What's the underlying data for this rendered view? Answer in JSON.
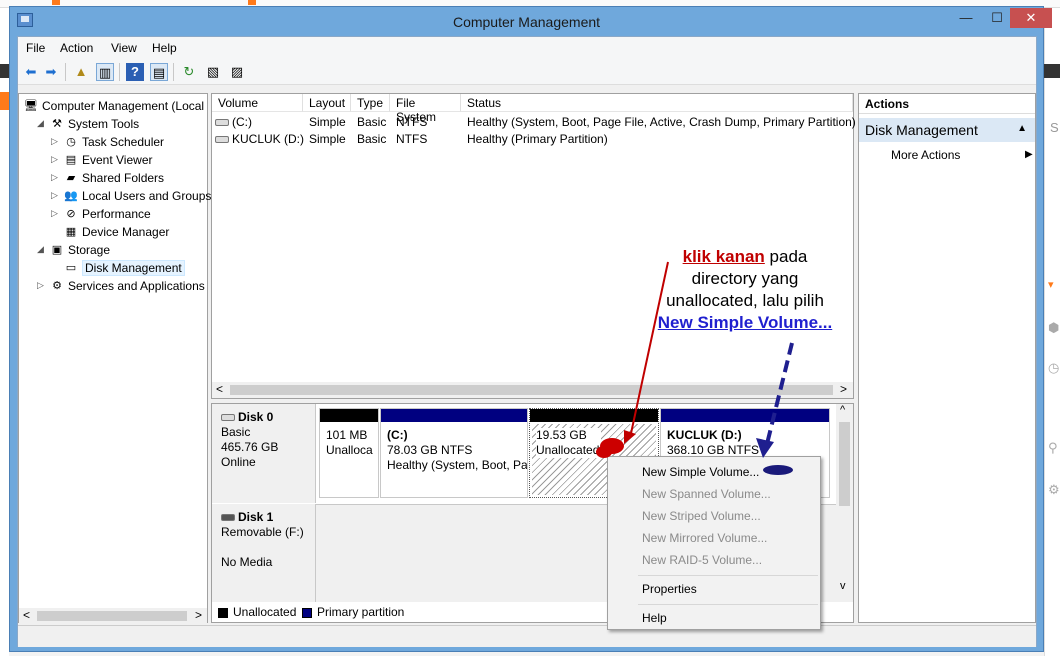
{
  "window": {
    "title": "Computer Management",
    "close_glyph": "✕",
    "min_glyph": "—",
    "max_glyph": "☐"
  },
  "menu": [
    "File",
    "Action",
    "View",
    "Help"
  ],
  "tree": {
    "items": [
      {
        "label": "Computer Management (Local",
        "icon": "computer-icon",
        "glyph": "🖥",
        "indent": 0,
        "twisty": ""
      },
      {
        "label": "System Tools",
        "icon": "tools-icon",
        "glyph": "⚒",
        "indent": 1,
        "twisty": "◢"
      },
      {
        "label": "Task Scheduler",
        "icon": "clock-icon",
        "glyph": "◷",
        "indent": 2,
        "twisty": "▷"
      },
      {
        "label": "Event Viewer",
        "icon": "event-viewer-icon",
        "glyph": "▤",
        "indent": 2,
        "twisty": "▷"
      },
      {
        "label": "Shared Folders",
        "icon": "shared-folder-icon",
        "glyph": "▰",
        "indent": 2,
        "twisty": "▷"
      },
      {
        "label": "Local Users and Groups",
        "icon": "users-icon",
        "glyph": "👥",
        "indent": 2,
        "twisty": "▷"
      },
      {
        "label": "Performance",
        "icon": "performance-icon",
        "glyph": "⊘",
        "indent": 2,
        "twisty": "▷"
      },
      {
        "label": "Device Manager",
        "icon": "device-manager-icon",
        "glyph": "▦",
        "indent": 2,
        "twisty": ""
      },
      {
        "label": "Storage",
        "icon": "storage-icon",
        "glyph": "▣",
        "indent": 1,
        "twisty": "◢"
      },
      {
        "label": "Disk Management",
        "icon": "disk-icon",
        "glyph": "▭",
        "indent": 2,
        "twisty": ""
      },
      {
        "label": "Services and Applications",
        "icon": "services-icon",
        "glyph": "⚙",
        "indent": 1,
        "twisty": "▷"
      }
    ],
    "scroll_left": "<",
    "scroll_right": ">"
  },
  "volumes": {
    "headers": [
      "Volume",
      "Layout",
      "Type",
      "File System",
      "Status"
    ],
    "rows": [
      [
        "(C:)",
        "Simple",
        "Basic",
        "NTFS",
        "Healthy (System, Boot, Page File, Active, Crash Dump, Primary Partition)"
      ],
      [
        "KUCLUK (D:)",
        "Simple",
        "Basic",
        "NTFS",
        "Healthy (Primary Partition)"
      ]
    ],
    "scroll_left": "<",
    "scroll_right": ">"
  },
  "disks": [
    {
      "name": "Disk 0",
      "type": "Basic",
      "size": "465.76 GB",
      "state": "Online"
    },
    {
      "name": "Disk 1",
      "type": "Removable (F:)",
      "size": "",
      "state": "No Media"
    }
  ],
  "partitions": [
    {
      "title": "",
      "line1": "101 MB",
      "line2": "Unalloca",
      "bar_color": "#000000"
    },
    {
      "title": "(C:)",
      "line1": "78.03 GB NTFS",
      "line2": "Healthy (System, Boot, Pa",
      "bar_color": "#000080"
    },
    {
      "title": "",
      "line1": "19.53 GB",
      "line2": "Unallocated",
      "bar_color": "#000000"
    },
    {
      "title": "KUCLUK  (D:)",
      "line1": "368.10 GB NTFS",
      "line2": "",
      "bar_color": "#000080"
    }
  ],
  "legend": {
    "unallocated": "Unallocated",
    "primary": "Primary partition",
    "unallocated_color": "#000000",
    "primary_color": "#000080"
  },
  "diskmap_scroll": {
    "up": "^",
    "down": "v"
  },
  "actions": {
    "header": "Actions",
    "section": "Disk Management",
    "section_arrow": "▲",
    "more": "More Actions",
    "more_arrow": "▶"
  },
  "context_menu": {
    "items": [
      {
        "label": "New Simple Volume...",
        "enabled": true
      },
      {
        "label": "New Spanned Volume...",
        "enabled": false
      },
      {
        "label": "New Striped Volume...",
        "enabled": false
      },
      {
        "label": "New Mirrored Volume...",
        "enabled": false
      },
      {
        "label": "New RAID-5 Volume...",
        "enabled": false
      },
      {
        "label": "Properties",
        "enabled": true
      },
      {
        "label": "Help",
        "enabled": true
      }
    ]
  },
  "annotation": {
    "red": "klik kanan",
    "line1_rest": " pada",
    "line2": "directory yang",
    "line3": "unallocated, lalu pilih",
    "blue": "New Simple Volume...",
    "red_color": "#c00000",
    "blue_color": "#1f1fcf"
  },
  "background_glyphs": [
    "S",
    "▾",
    "⬢",
    "◷",
    "⚲",
    "⚙"
  ]
}
